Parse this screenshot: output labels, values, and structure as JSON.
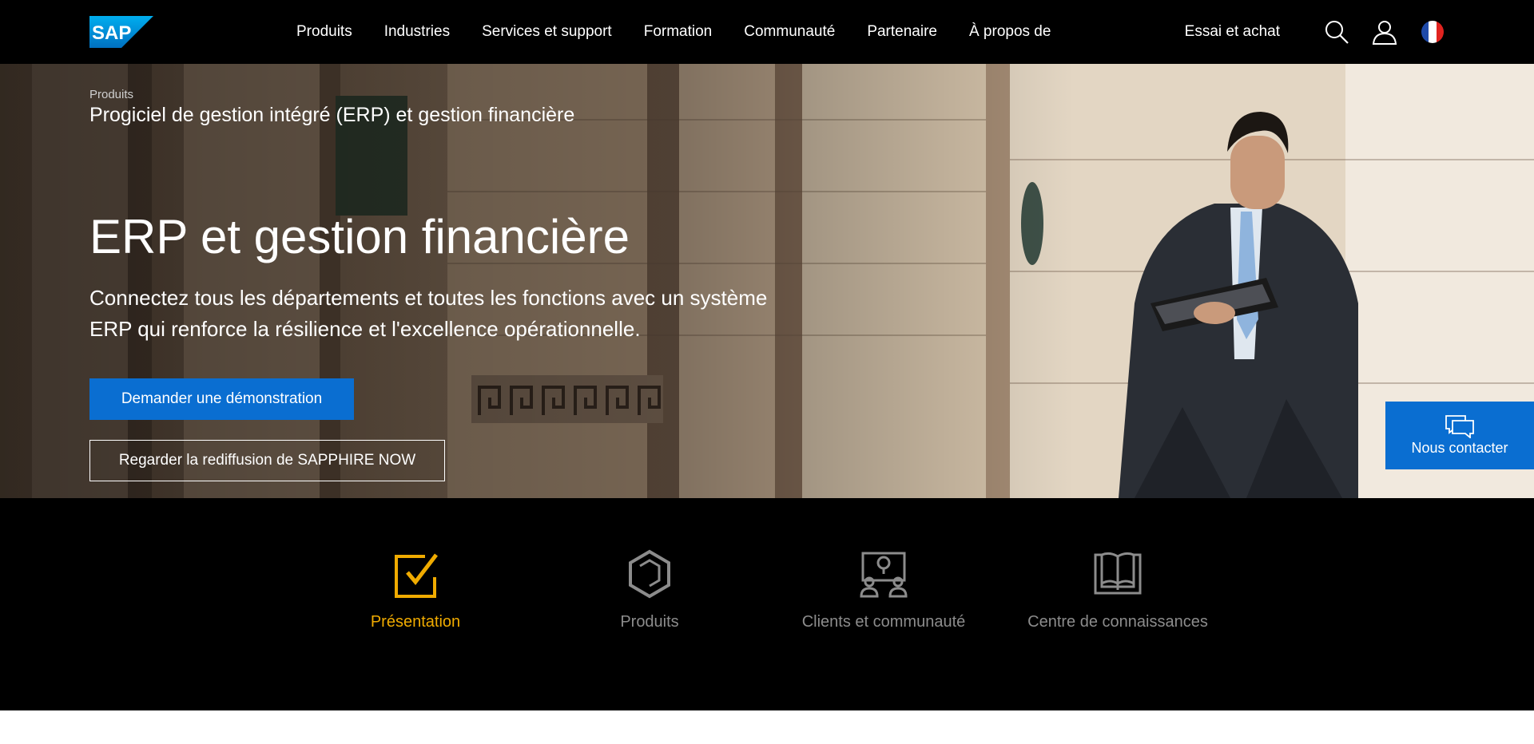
{
  "header": {
    "logo_text": "SAP",
    "nav": [
      "Produits",
      "Industries",
      "Services et support",
      "Formation",
      "Communauté",
      "Partenaire",
      "À propos de"
    ],
    "trial_label": "Essai et achat",
    "icons": [
      "search-icon",
      "user-icon",
      "flag-france-icon"
    ]
  },
  "hero": {
    "breadcrumb": "Produits",
    "subtitle": "Progiciel de gestion intégré (ERP) et gestion financière",
    "title": "ERP et gestion financière",
    "description": "Connectez tous les départements et toutes les fonctions avec un système ERP qui renforce la résilience et l'excellence opérationnelle.",
    "primary_button": "Demander une démonstration",
    "secondary_button": "Regarder la rediffusion de SAPPHIRE NOW"
  },
  "contact": {
    "label": "Nous contacter",
    "icon": "chat-icon"
  },
  "tabs": [
    {
      "label": "Présentation",
      "icon": "checkbox-icon",
      "active": true
    },
    {
      "label": "Produits",
      "icon": "cube-icon",
      "active": false
    },
    {
      "label": "Clients et communauté",
      "icon": "community-icon",
      "active": false
    },
    {
      "label": "Centre de connaissances",
      "icon": "book-icon",
      "active": false
    }
  ],
  "colors": {
    "accent_blue": "#0a6ed1",
    "active_tab": "#f0ab00",
    "inactive_tab": "#8c8c8c",
    "header_bg": "#000000"
  }
}
